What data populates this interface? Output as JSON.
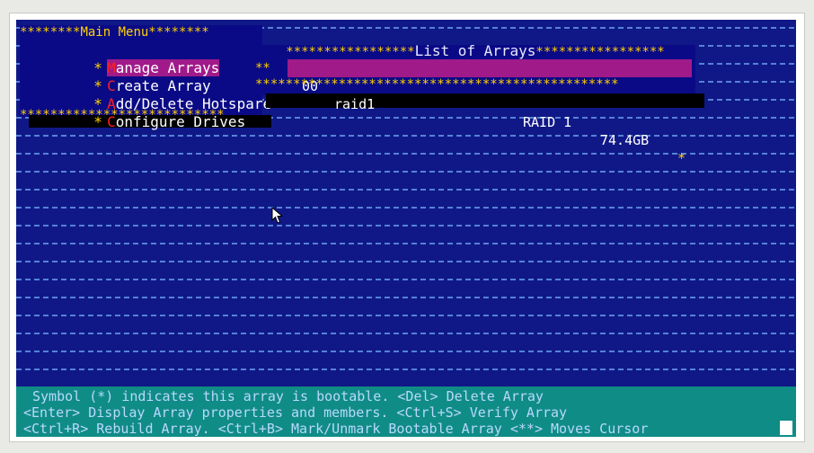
{
  "main_menu": {
    "title": "Main Menu",
    "items": [
      {
        "hotkey": "M",
        "rest": "anage Arrays",
        "selected": true
      },
      {
        "hotkey": "C",
        "rest": "reate Array",
        "selected": false
      },
      {
        "hotkey": "A",
        "rest": "dd/Delete Hotspare",
        "selected": false
      },
      {
        "hotkey": "C",
        "rest": "onfigure Drives",
        "selected": false
      }
    ]
  },
  "array_list": {
    "title": "List of Arrays",
    "rows": [
      {
        "number": "00",
        "name": "raid1",
        "level": "RAID 1",
        "size": "74.4GB",
        "bootable_marker": "*"
      }
    ]
  },
  "help_bar": {
    "line1": "Symbol (*) indicates this array is bootable. <Del> Delete Array",
    "line2": "<Enter> Display Array properties and members. <Ctrl+S> Verify Array",
    "line3": "<Ctrl+R> Rebuild Array. <Ctrl+B> Mark/Unmark Bootable Array <**> Moves Cursor"
  },
  "colors": {
    "background": "#101887",
    "menu_border": "#ffd200",
    "selection": "#a01a8a",
    "help_bar": "#108c86"
  }
}
